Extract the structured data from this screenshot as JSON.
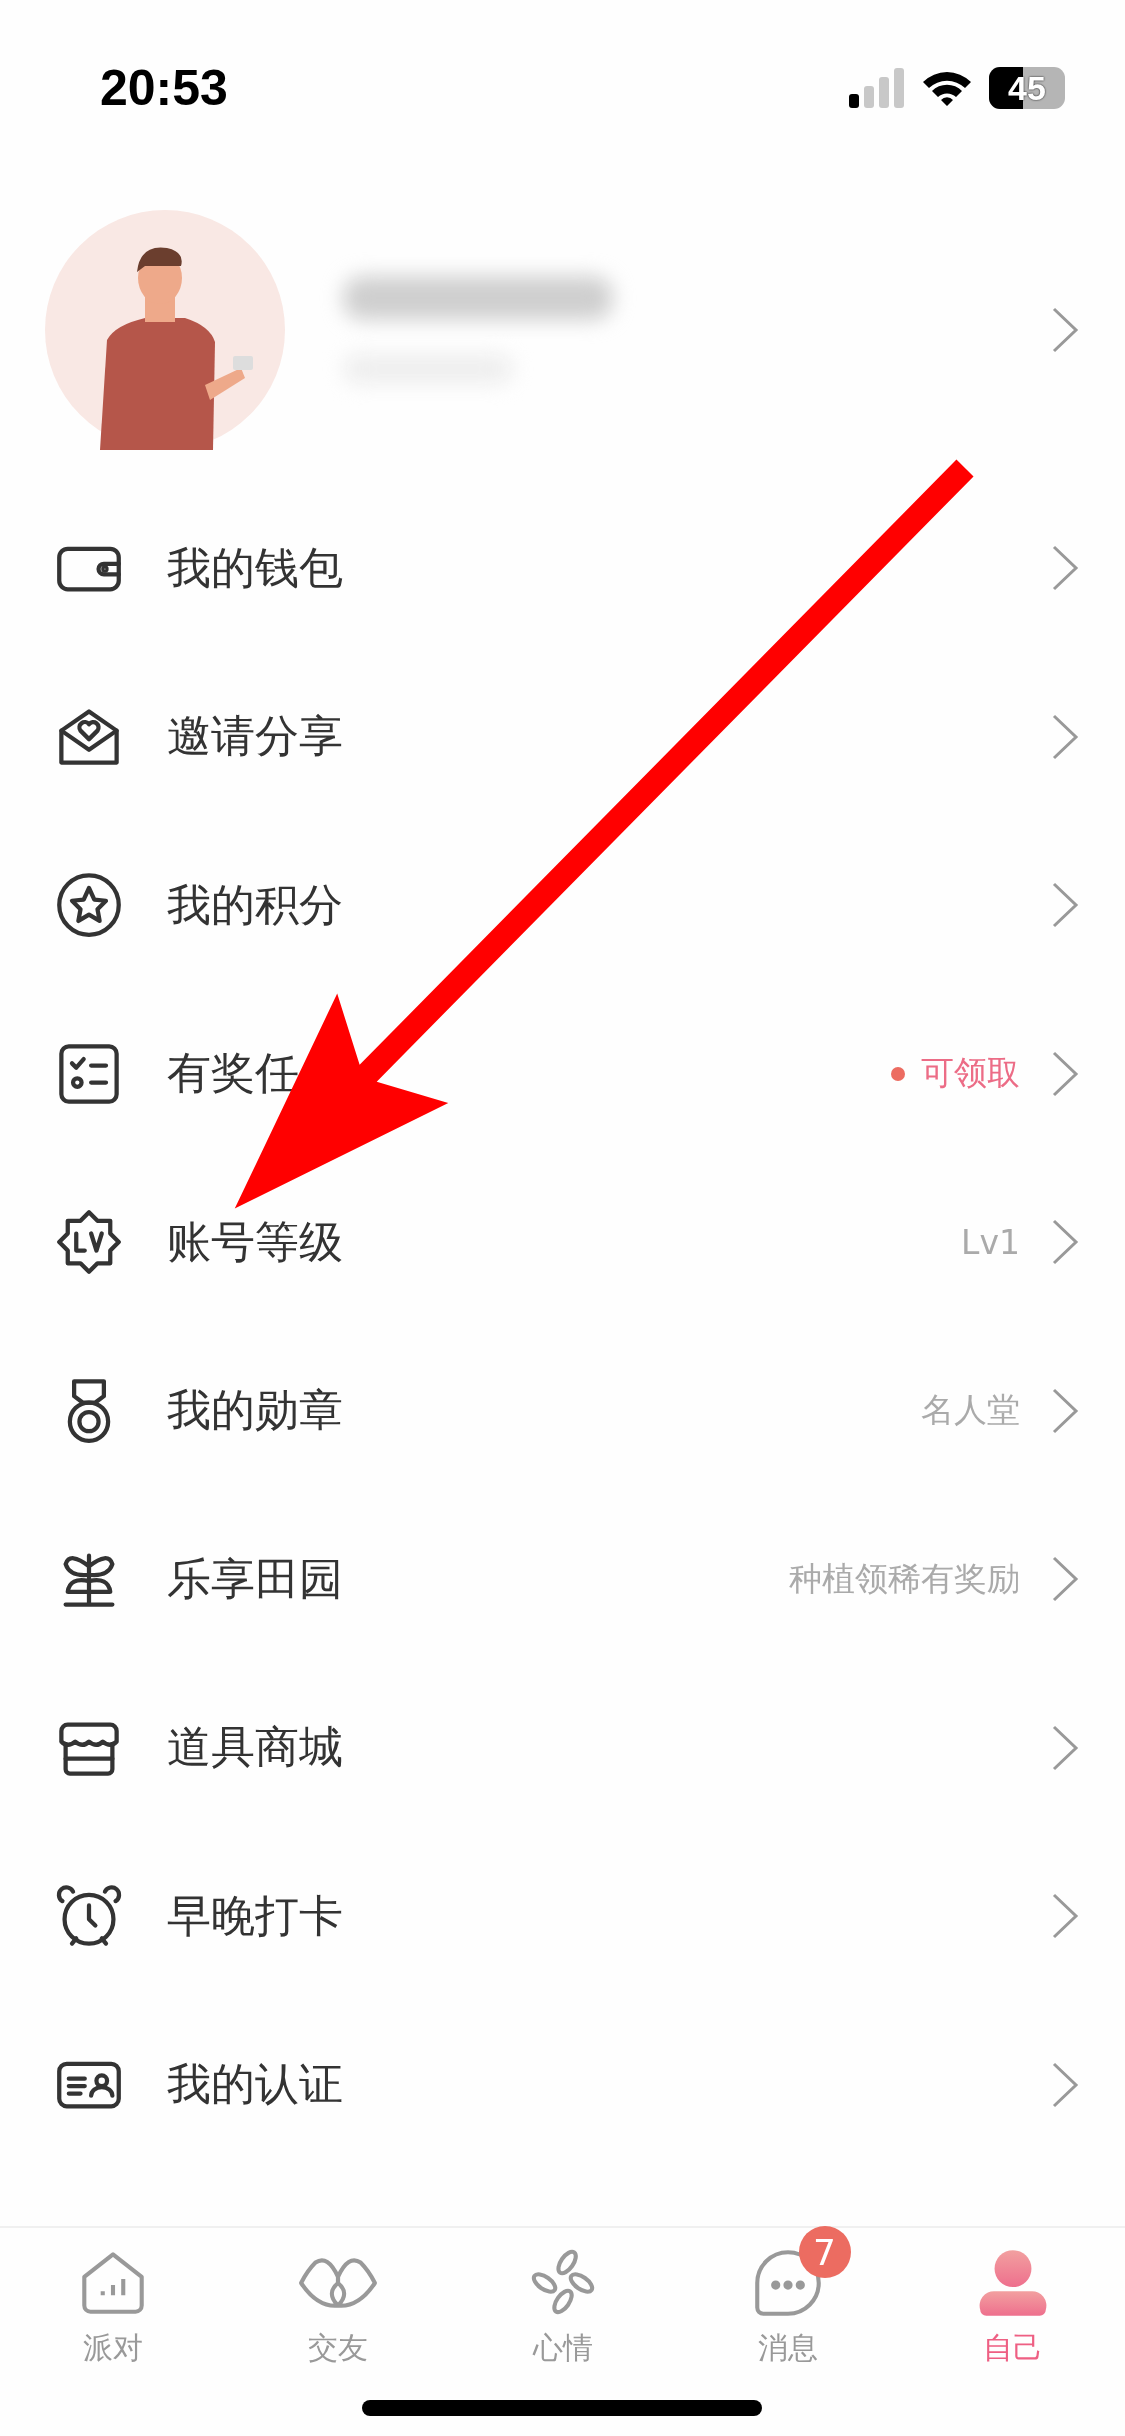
{
  "status_bar": {
    "time": "20:53",
    "battery": "45"
  },
  "menu": [
    {
      "label": "我的钱包"
    },
    {
      "label": "邀请分享"
    },
    {
      "label": "我的积分"
    },
    {
      "label": "有奖任",
      "detail": "可领取",
      "kind": "alert"
    },
    {
      "label": "账号等级",
      "detail": "Lv1",
      "kind": "note"
    },
    {
      "label": "我的勋章",
      "detail": "名人堂",
      "kind": "note"
    },
    {
      "label": "乐享田园",
      "detail": "种植领稀有奖励",
      "kind": "note"
    },
    {
      "label": "道具商城"
    },
    {
      "label": "早晚打卡"
    },
    {
      "label": "我的认证"
    }
  ],
  "tab_bar": [
    {
      "label": "派对",
      "selected": false
    },
    {
      "label": "交友",
      "selected": false
    },
    {
      "label": "心情",
      "selected": false
    },
    {
      "label": "消息",
      "selected": false,
      "badge": "7"
    },
    {
      "label": "自己",
      "selected": true
    }
  ]
}
